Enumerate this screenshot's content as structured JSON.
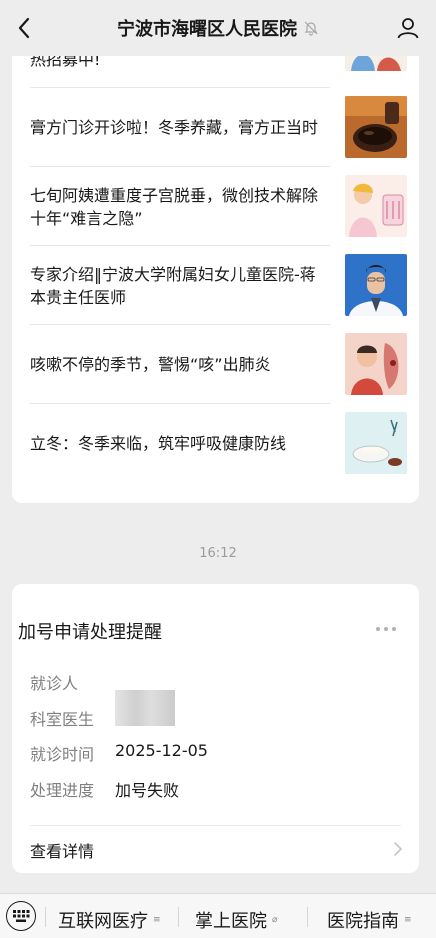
{
  "header": {
    "title": "宁波市海曙区人民医院",
    "back_icon": "chevron-left-icon",
    "mute_icon": "bell-off-icon",
    "profile_icon": "person-icon"
  },
  "articles": [
    {
      "title": "热招募中!"
    },
    {
      "title": "膏方门诊开诊啦！冬季养藏，膏方正当时"
    },
    {
      "title": "七旬阿姨遭重度子宫脱垂，微创技术解除十年“难言之隐”"
    },
    {
      "title": "专家介绍‖宁波大学附属妇女儿童医院-蒋本贵主任医师"
    },
    {
      "title": "咳嗽不停的季节，警惕“咳”出肺炎"
    },
    {
      "title": "立冬：冬季来临，筑牢呼吸健康防线"
    }
  ],
  "timestamp": "16:12",
  "notice": {
    "title": "加号申请处理提醒",
    "rows": [
      {
        "label": "就诊人",
        "value": ""
      },
      {
        "label": "科室医生",
        "value": ""
      },
      {
        "label": "就诊时间",
        "value": "2025-12-05"
      },
      {
        "label": "处理进度",
        "value": "加号失败"
      }
    ],
    "detail_label": "查看详情"
  },
  "bottom_menu": {
    "items": [
      {
        "label": "互联网医疗"
      },
      {
        "label": "掌上医院"
      },
      {
        "label": "医院指南"
      }
    ]
  }
}
